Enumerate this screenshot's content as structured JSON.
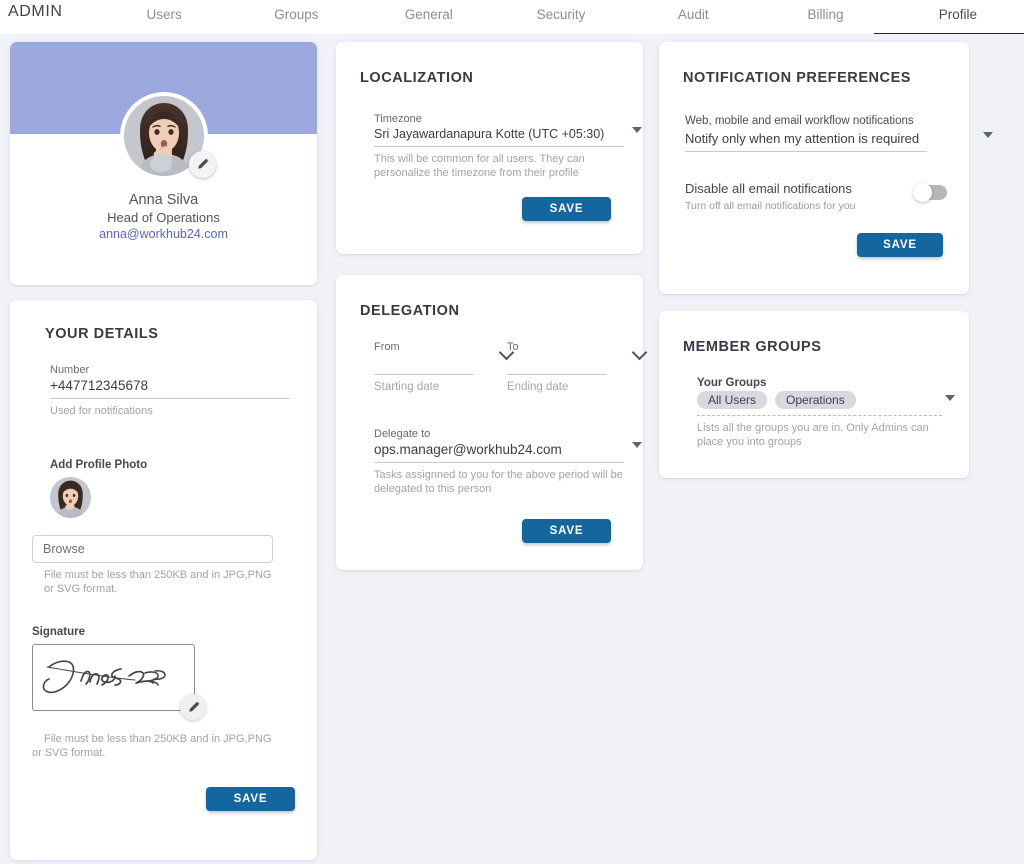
{
  "nav": {
    "brand": "ADMIN",
    "tabs": [
      {
        "label": "Users",
        "active": false
      },
      {
        "label": "Groups",
        "active": false
      },
      {
        "label": "General",
        "active": false
      },
      {
        "label": "Security",
        "active": false
      },
      {
        "label": "Audit",
        "active": false
      },
      {
        "label": "Billing",
        "active": false
      },
      {
        "label": "Profile",
        "active": true
      }
    ]
  },
  "profile": {
    "name": "Anna Silva",
    "role": "Head of Operations",
    "email": "anna@workhub24.com",
    "banner_color": "#9ca9df",
    "email_color": "#5b63d6"
  },
  "details": {
    "title": "YOUR DETAILS",
    "number_label": "Number",
    "number_value": "+447712345678",
    "number_hint": "Used for notifications",
    "add_photo_label": "Add Profile Photo",
    "browse_placeholder": "Browse",
    "browse_hint": "File must be less than 250KB and in JPG,PNG or SVG format.",
    "signature_label": "Signature",
    "signature_hint": "File must be less than 250KB and in JPG,PNG or SVG format.",
    "save_label": "SAVE"
  },
  "localization": {
    "title": "LOCALIZATION",
    "timezone_label": "Timezone",
    "timezone_value": "Sri Jayawardanapura Kotte (UTC +05:30)",
    "timezone_hint": "This will be common for all users. They can personalize the timezone from their profile",
    "save_label": "SAVE"
  },
  "delegation": {
    "title": "DELEGATION",
    "from_label": "From",
    "from_placeholder": "Starting date",
    "to_label": "To",
    "to_placeholder": "Ending date",
    "delegate_label": "Delegate to",
    "delegate_value": "ops.manager@workhub24.com",
    "delegate_hint": "Tasks assignned to you for the above period will be delegated to this person",
    "save_label": "SAVE"
  },
  "notifications": {
    "title": "NOTIFICATION PREFERENCES",
    "workflow_label": "Web, mobile and email workflow notifications",
    "workflow_value": "Notify only when my attention is required",
    "disable_label": "Disable all email notifications",
    "disable_sub": "Turn off all email notifications for you",
    "toggle_state": "off",
    "save_label": "SAVE"
  },
  "member_groups": {
    "title": "MEMBER GROUPS",
    "your_groups_label": "Your Groups",
    "chips": [
      "All Users",
      "Operations"
    ],
    "hint": "Lists all the groups you are in. Only Admins can place you into groups"
  },
  "theme": {
    "page_background": "#f1f2f8",
    "save_button_color": "#14669f",
    "active_tab_underline": "#23234a"
  }
}
